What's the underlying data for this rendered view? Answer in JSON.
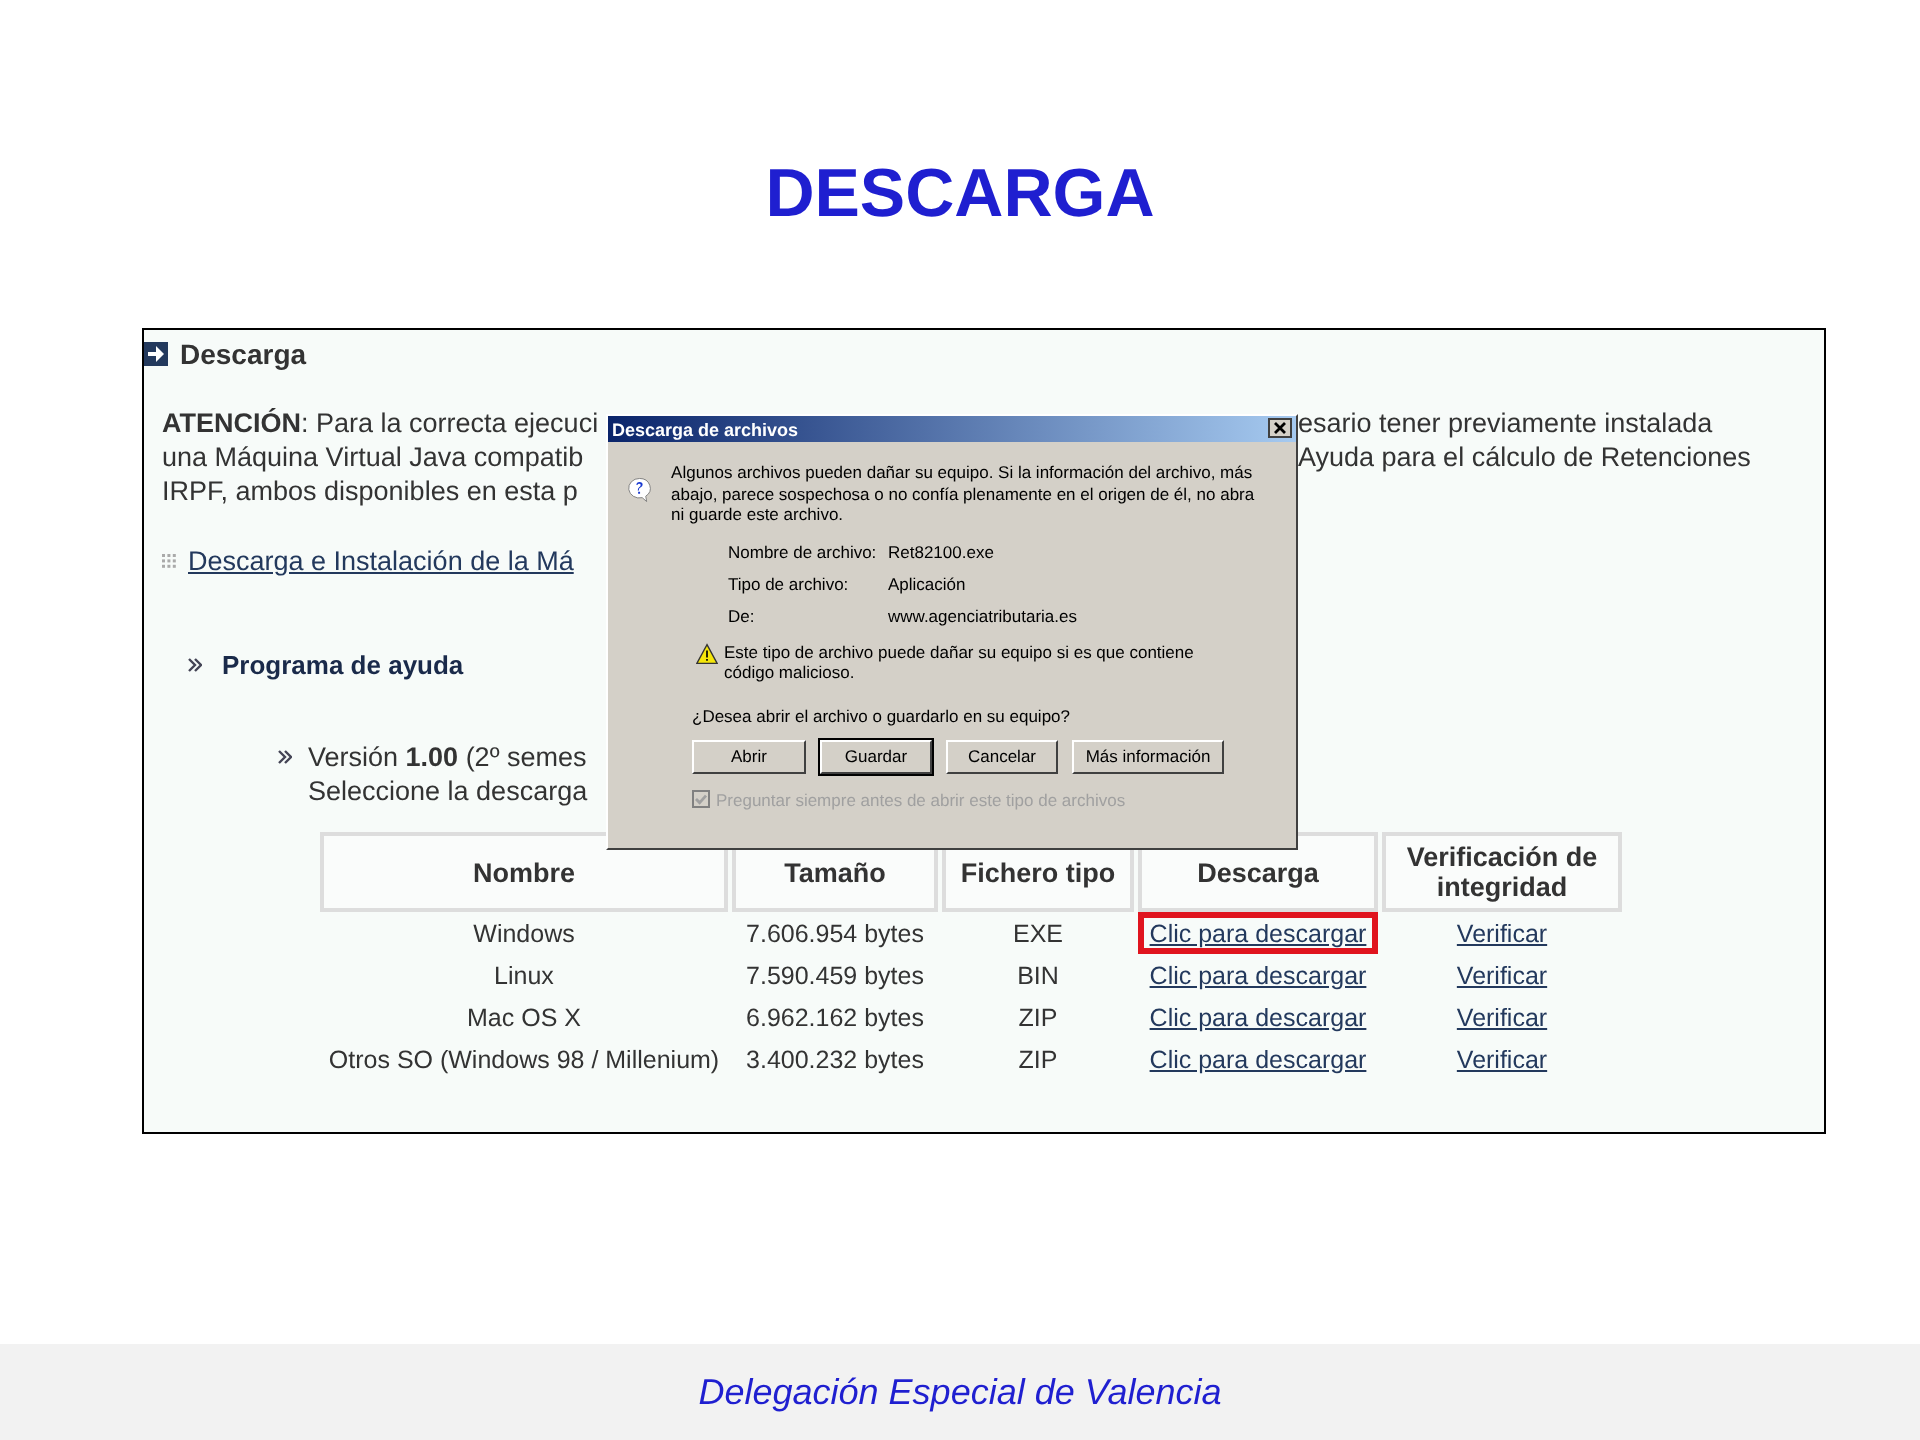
{
  "slide_title": "DESCARGA",
  "web_page": {
    "section_title": "Descarga",
    "notice_lines": [
      {
        "left": "**ATENCIÓN**: Para la correcta ejecuci",
        "right": "esario tener previamente instalada"
      },
      {
        "left": "una Máquina Virtual Java compatib",
        "right": "Ayuda para el cálculo de Retenciones"
      },
      {
        "left": "IRPF, ambos disponibles en esta p"
      }
    ],
    "java_link": "Descarga e Instalación de la Má",
    "subsection": "Programa de ayuda",
    "version_lines": [
      "Versión **1.00** (2º semes",
      "Seleccione la descarga"
    ],
    "table": {
      "columns": [
        "Nombre",
        "Tamaño",
        "Fichero tipo",
        "Descarga",
        "Verificación de integridad"
      ],
      "rows": [
        {
          "name": "Windows",
          "size": "7.606.954 bytes",
          "type": "EXE",
          "download": "Clic para descargar",
          "verify": "Verificar",
          "highlighted": true
        },
        {
          "name": "Linux",
          "size": "7.590.459 bytes",
          "type": "BIN",
          "download": "Clic para descargar",
          "verify": "Verificar",
          "highlighted": false
        },
        {
          "name": "Mac OS X",
          "size": "6.962.162 bytes",
          "type": "ZIP",
          "download": "Clic para descargar",
          "verify": "Verificar",
          "highlighted": false
        },
        {
          "name": "Otros SO (Windows 98 / Millenium)",
          "size": "3.400.232 bytes",
          "type": "ZIP",
          "download": "Clic para descargar",
          "verify": "Verificar",
          "highlighted": false
        }
      ]
    }
  },
  "dialog": {
    "title": "Descarga de archivos",
    "message": "Algunos archivos pueden dañar su equipo. Si la información del archivo, más abajo, parece sospechosa o no confía plenamente en el origen de él, no abra ni guarde este archivo.",
    "fields": [
      {
        "label": "Nombre de archivo:",
        "value": "Ret82100.exe"
      },
      {
        "label": "Tipo de archivo:",
        "value": "Aplicación"
      },
      {
        "label": "De:",
        "value": "www.agenciatributaria.es"
      }
    ],
    "warning": "Este tipo de archivo puede dañar su equipo si es que contiene código malicioso.",
    "question": "¿Desea abrir el archivo o guardarlo en su equipo?",
    "buttons": [
      {
        "label": "Abrir",
        "default": false
      },
      {
        "label": "Guardar",
        "default": true
      },
      {
        "label": "Cancelar",
        "default": false
      },
      {
        "label": "Más información",
        "default": false
      }
    ],
    "checkbox": {
      "label": "Preguntar siempre antes de abrir este tipo de archivos",
      "checked": true,
      "disabled": true
    }
  },
  "footer": "Delegación Especial de Valencia"
}
